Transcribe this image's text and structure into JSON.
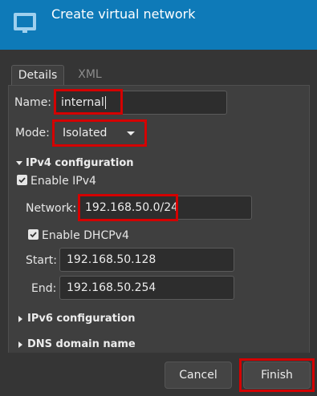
{
  "header": {
    "title": "Create virtual network",
    "icon": "network-icon"
  },
  "tabs": [
    {
      "label": "Details",
      "active": true
    },
    {
      "label": "XML",
      "active": false
    }
  ],
  "form": {
    "name_label": "Name:",
    "name_value": "internal",
    "mode_label": "Mode:",
    "mode_value": "Isolated"
  },
  "ipv4": {
    "section_label": "IPv4 configuration",
    "expanded": true,
    "enable_label": "Enable IPv4",
    "enable_checked": true,
    "network_label": "Network:",
    "network_value": "192.168.50.0/24",
    "dhcp_label": "Enable DHCPv4",
    "dhcp_checked": true,
    "start_label": "Start:",
    "start_value": "192.168.50.128",
    "end_label": "End:",
    "end_value": "192.168.50.254"
  },
  "ipv6": {
    "section_label": "IPv6 configuration",
    "expanded": false
  },
  "dns": {
    "section_label": "DNS domain name",
    "expanded": false
  },
  "footer": {
    "cancel_label": "Cancel",
    "finish_label": "Finish"
  },
  "colors": {
    "header_bg": "#0e7ab8",
    "highlight": "#d40000",
    "window_bg": "#353535"
  }
}
